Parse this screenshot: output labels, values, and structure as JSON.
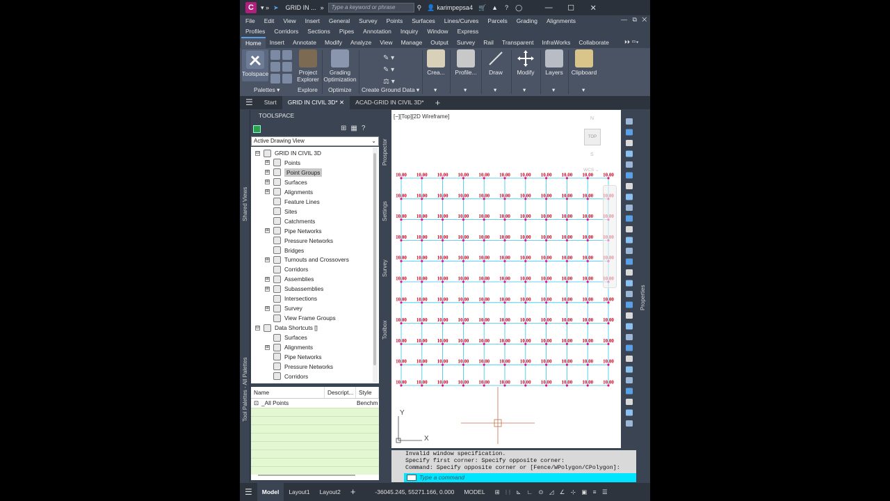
{
  "titlebar": {
    "logo": "C",
    "doc_title": "GRID IN ...",
    "search_placeholder": "Type a keyword or phrase",
    "user": "karimpepsa4",
    "minimize": "—",
    "maximize": "☐",
    "close": "✕"
  },
  "menu": {
    "row1": [
      "File",
      "Edit",
      "View",
      "Insert",
      "General",
      "Survey",
      "Points",
      "Surfaces",
      "Lines/Curves",
      "Parcels",
      "Grading",
      "Alignments"
    ],
    "row2": [
      "Profiles",
      "Corridors",
      "Sections",
      "Pipes",
      "Annotation",
      "Inquiry",
      "Window",
      "Express"
    ]
  },
  "ribbon_tabs": [
    "Home",
    "Insert",
    "Annotate",
    "Modify",
    "Analyze",
    "View",
    "Manage",
    "Output",
    "Survey",
    "Rail",
    "Transparent",
    "InfraWorks",
    "Collaborate"
  ],
  "ribbon": {
    "toolspace": "Toolspace",
    "project_explorer": [
      "Project",
      "Explorer"
    ],
    "grading_optimization": [
      "Grading",
      "Optimization"
    ],
    "create": "Crea...",
    "profile": "Profile...",
    "draw": "Draw",
    "modify": "Modify",
    "layers": "Layers",
    "clipboard": "Clipboard",
    "panel_palettes": "Palettes",
    "panel_explore": "Explore",
    "panel_optimize": "Optimize",
    "panel_create_ground": "Create Ground Data"
  },
  "file_tabs": [
    "Start",
    "GRID IN CIVIL 3D*",
    "ACAD-GRID IN CIVIL 3D*"
  ],
  "toolspace": {
    "title": "TOOLSPACE",
    "view_select": "Active Drawing View",
    "left_vertical": [
      "Shared Views",
      "Tool Palettes - All Palettes"
    ],
    "side_tabs": [
      "Prospector",
      "Settings",
      "Survey",
      "Toolbox"
    ],
    "tree": [
      {
        "label": "GRID IN CIVIL 3D",
        "level": 0,
        "exp": "⊟"
      },
      {
        "label": "Points",
        "level": 1,
        "exp": "⊞"
      },
      {
        "label": "Point Groups",
        "level": 1,
        "exp": "⊞",
        "selected": true
      },
      {
        "label": "Surfaces",
        "level": 1,
        "exp": "⊞"
      },
      {
        "label": "Alignments",
        "level": 1,
        "exp": "⊞"
      },
      {
        "label": "Feature Lines",
        "level": 1,
        "exp": ""
      },
      {
        "label": "Sites",
        "level": 1,
        "exp": ""
      },
      {
        "label": "Catchments",
        "level": 1,
        "exp": ""
      },
      {
        "label": "Pipe Networks",
        "level": 1,
        "exp": "⊞"
      },
      {
        "label": "Pressure Networks",
        "level": 1,
        "exp": ""
      },
      {
        "label": "Bridges",
        "level": 1,
        "exp": ""
      },
      {
        "label": "Turnouts and Crossovers",
        "level": 1,
        "exp": "⊞"
      },
      {
        "label": "Corridors",
        "level": 1,
        "exp": ""
      },
      {
        "label": "Assemblies",
        "level": 1,
        "exp": "⊞"
      },
      {
        "label": "Subassemblies",
        "level": 1,
        "exp": "⊞"
      },
      {
        "label": "Intersections",
        "level": 1,
        "exp": ""
      },
      {
        "label": "Survey",
        "level": 1,
        "exp": "⊞"
      },
      {
        "label": "View Frame Groups",
        "level": 1,
        "exp": ""
      },
      {
        "label": "Data Shortcuts []",
        "level": 0,
        "exp": "⊟"
      },
      {
        "label": "Surfaces",
        "level": 1,
        "exp": ""
      },
      {
        "label": "Alignments",
        "level": 1,
        "exp": "⊞"
      },
      {
        "label": "Pipe Networks",
        "level": 1,
        "exp": ""
      },
      {
        "label": "Pressure Networks",
        "level": 1,
        "exp": ""
      },
      {
        "label": "Corridors",
        "level": 1,
        "exp": ""
      }
    ],
    "grid_headers": [
      "Name",
      "Descript...",
      "Style"
    ],
    "grid_row": {
      "name": "_All Points",
      "desc": "",
      "style": "Benchm"
    }
  },
  "viewport": {
    "label": "[−][Top][2D Wireframe]",
    "viewcube": {
      "n": "N",
      "top": "TOP",
      "s": "S",
      "wcs": "WCS"
    },
    "point_label": "10.00",
    "ucs": {
      "y": "Y",
      "x": "X"
    }
  },
  "right_panel": {
    "properties": "Properties"
  },
  "command": {
    "history": [
      "Invalid window specification.",
      "Specify first corner: Specify opposite corner:",
      "Command: Specify opposite corner or [Fence/WPolygon/CPolygon]:"
    ],
    "placeholder": "Type a command"
  },
  "status": {
    "layouts": [
      "Model",
      "Layout1",
      "Layout2"
    ],
    "coords": "-36045.245, 55271.166, 0.000",
    "mode": "MODEL"
  },
  "colors": {
    "accent": "#5aa0e6",
    "point_label": "#c8001e",
    "grid_line": "#2fc7e8",
    "point_mark": "#e0138b",
    "cmd_input": "#00e5ff"
  }
}
